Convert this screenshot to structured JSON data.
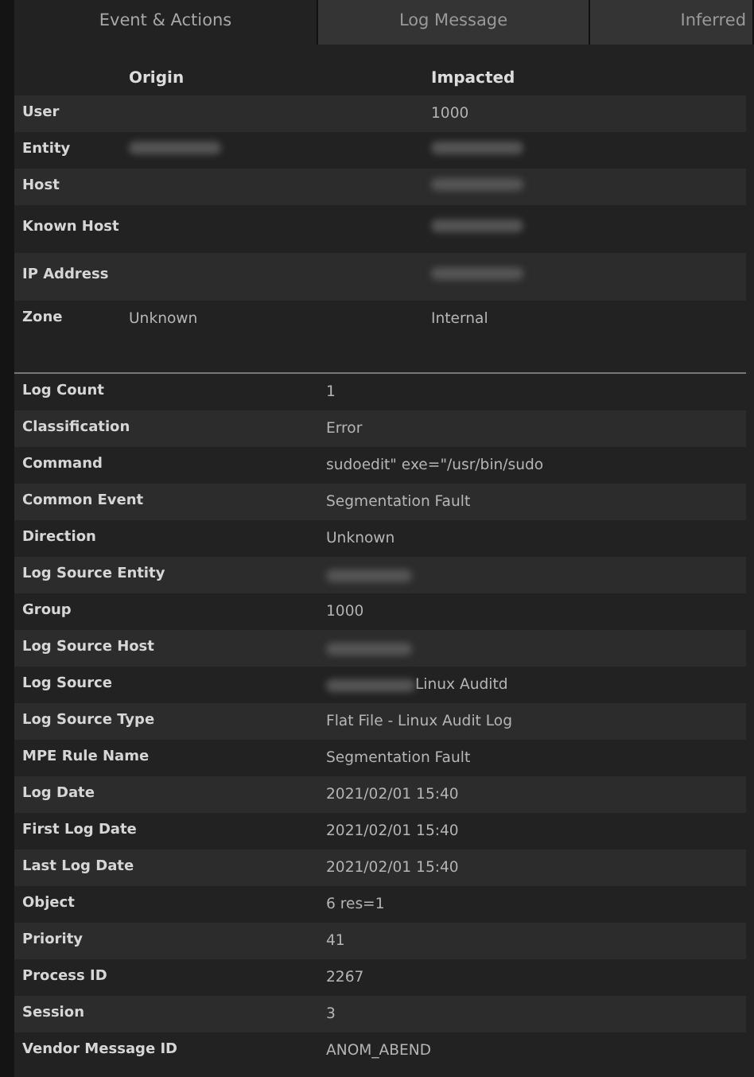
{
  "tabs": [
    {
      "label": "Event & Actions",
      "selected": true
    },
    {
      "label": "Log Message",
      "selected": false
    },
    {
      "label": "Inferred",
      "selected": false
    }
  ],
  "hosts_table": {
    "columns": [
      "Origin",
      "Impacted"
    ],
    "rows": [
      {
        "label": "User",
        "impacted": {
          "text": "1000"
        }
      },
      {
        "label": "Entity",
        "origin": {
          "redacted": true
        },
        "impacted": {
          "redacted": true
        }
      },
      {
        "label": "Host",
        "impacted": {
          "redacted": true
        }
      },
      {
        "label": "Known Host",
        "impacted": {
          "redacted": true
        }
      },
      {
        "label": "IP Address",
        "impacted": {
          "redacted": true
        }
      },
      {
        "label": "Zone",
        "origin": {
          "text": "Unknown"
        },
        "impacted": {
          "text": "Internal"
        }
      }
    ]
  },
  "details": [
    {
      "label": "Log Count",
      "value": "1"
    },
    {
      "label": "Classification",
      "value": "Error"
    },
    {
      "label": "Command",
      "value": "sudoedit\" exe=\"/usr/bin/sudo"
    },
    {
      "label": "Common Event",
      "value": "Segmentation Fault"
    },
    {
      "label": "Direction",
      "value": "Unknown"
    },
    {
      "label": "Log Source Entity",
      "redacted": true
    },
    {
      "label": "Group",
      "value": "1000"
    },
    {
      "label": "Log Source Host",
      "redacted": true
    },
    {
      "label": "Log Source",
      "value": "Linux Auditd",
      "redacted": true
    },
    {
      "label": "Log Source Type",
      "value": "Flat File - Linux Audit Log"
    },
    {
      "label": "MPE Rule Name",
      "value": "Segmentation Fault"
    },
    {
      "label": "Log Date",
      "value": "2021/02/01 15:40"
    },
    {
      "label": "First Log Date",
      "value": "2021/02/01 15:40"
    },
    {
      "label": "Last Log Date",
      "value": "2021/02/01 15:40"
    },
    {
      "label": "Object",
      "value": "6 res=1"
    },
    {
      "label": "Priority",
      "value": "41"
    },
    {
      "label": "Process ID",
      "value": "2267"
    },
    {
      "label": "Session",
      "value": "3"
    },
    {
      "label": "Vendor Message ID",
      "value": "ANOM_ABEND"
    }
  ]
}
